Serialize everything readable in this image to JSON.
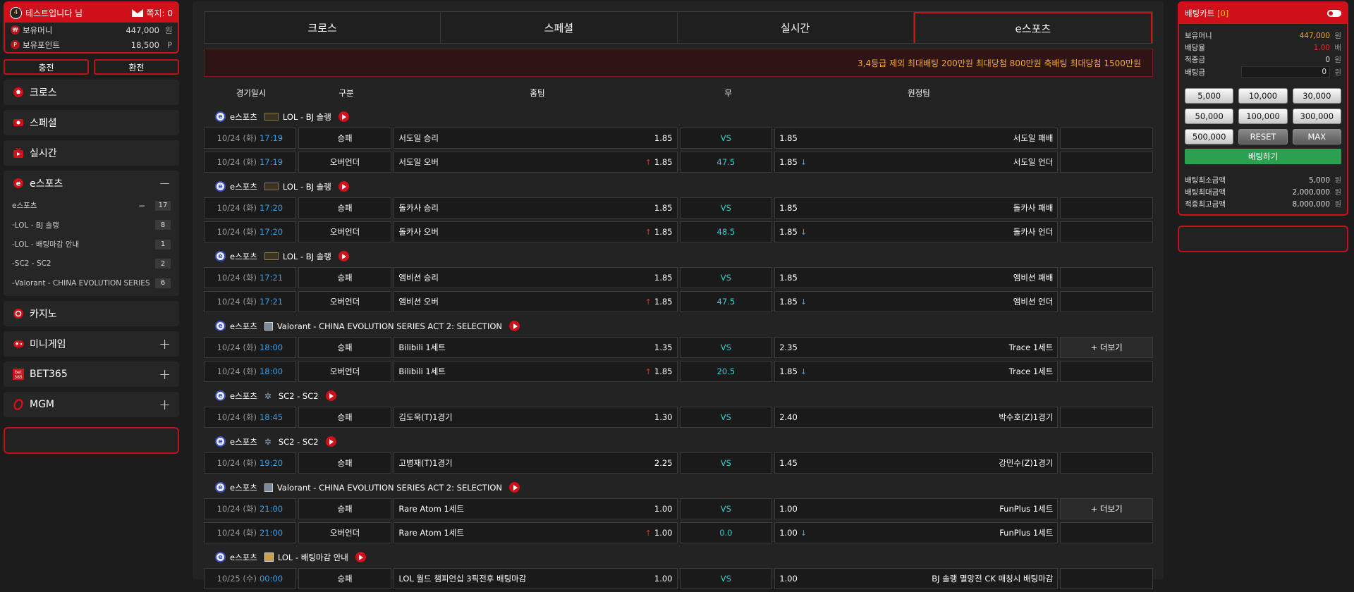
{
  "user": {
    "level": "4",
    "name": "테스트입니다 님",
    "mail_label": "쪽지: 0",
    "money_label": "보유머니",
    "money_value": "447,000",
    "money_unit": "원",
    "point_label": "보유포인트",
    "point_value": "18,500",
    "point_unit": "P"
  },
  "cash": {
    "charge": "충전",
    "exchange": "환전"
  },
  "menu": {
    "cross": "크로스",
    "special": "스페셜",
    "live": "실시간",
    "esports": "e스포츠",
    "esports_sub": [
      {
        "label": "e스포츠",
        "count": "17",
        "top": true
      },
      {
        "label": "LOL - BJ 솔랭",
        "count": "8"
      },
      {
        "label": "LOL - 배팅마감 안내",
        "count": "1"
      },
      {
        "label": "SC2 - SC2",
        "count": "2"
      },
      {
        "label": "Valorant - CHINA EVOLUTION SERIES ACT 2: SELECTION",
        "count": "6"
      }
    ],
    "casino": "카지노",
    "minigame": "미니게임",
    "bet365": "BET365",
    "mgm": "MGM"
  },
  "tabs": [
    "크로스",
    "스페셜",
    "실시간",
    "e스포츠"
  ],
  "notice": "3,4등급 제외 최대배팅 200만원 최대당첨 800만원 축배팅 최대당첨 1500만원",
  "headers": {
    "time": "경기일시",
    "type": "구분",
    "home": "홈팀",
    "draw": "무",
    "away": "원정팀"
  },
  "groups": [
    {
      "sport": "e스포츠",
      "league": "LOL - BJ 솔랭",
      "icon": "lol-bj-icon",
      "rows": [
        {
          "date": "10/24 (화)",
          "time": "17:19",
          "type": "승패",
          "home": "서도일 승리",
          "home_odds": "1.85",
          "draw": "VS",
          "away_odds": "1.85",
          "away": "서도일 패배",
          "more": ""
        },
        {
          "date": "10/24 (화)",
          "time": "17:19",
          "type": "오버언더",
          "home": "서도일 오버",
          "home_odds": "1.85",
          "draw": "47.5",
          "away_odds": "1.85",
          "away": "서도일 언더",
          "more": "",
          "ou": true
        }
      ]
    },
    {
      "sport": "e스포츠",
      "league": "LOL - BJ 솔랭",
      "icon": "lol-bj-icon",
      "rows": [
        {
          "date": "10/24 (화)",
          "time": "17:20",
          "type": "승패",
          "home": "돌카사 승리",
          "home_odds": "1.85",
          "draw": "VS",
          "away_odds": "1.85",
          "away": "돌카사 패배",
          "more": ""
        },
        {
          "date": "10/24 (화)",
          "time": "17:20",
          "type": "오버언더",
          "home": "돌카사 오버",
          "home_odds": "1.85",
          "draw": "48.5",
          "away_odds": "1.85",
          "away": "돌카사 언더",
          "more": "",
          "ou": true
        }
      ]
    },
    {
      "sport": "e스포츠",
      "league": "LOL - BJ 솔랭",
      "icon": "lol-bj-icon",
      "rows": [
        {
          "date": "10/24 (화)",
          "time": "17:21",
          "type": "승패",
          "home": "앰비션 승리",
          "home_odds": "1.85",
          "draw": "VS",
          "away_odds": "1.85",
          "away": "앰비션 패배",
          "more": ""
        },
        {
          "date": "10/24 (화)",
          "time": "17:21",
          "type": "오버언더",
          "home": "앰비션 오버",
          "home_odds": "1.85",
          "draw": "47.5",
          "away_odds": "1.85",
          "away": "앰비션 언더",
          "more": "",
          "ou": true
        }
      ]
    },
    {
      "sport": "e스포츠",
      "league": "Valorant - CHINA EVOLUTION SERIES ACT 2: SELECTION",
      "icon": "valorant-icon",
      "rows": [
        {
          "date": "10/24 (화)",
          "time": "18:00",
          "type": "승패",
          "home": "Bilibili 1세트",
          "home_odds": "1.35",
          "draw": "VS",
          "away_odds": "2.35",
          "away": "Trace 1세트",
          "more": "+ 더보기"
        },
        {
          "date": "10/24 (화)",
          "time": "18:00",
          "type": "오버언더",
          "home": "Bilibili 1세트",
          "home_odds": "1.85",
          "draw": "20.5",
          "away_odds": "1.85",
          "away": "Trace 1세트",
          "more": "",
          "ou": true
        }
      ]
    },
    {
      "sport": "e스포츠",
      "league": "SC2 - SC2",
      "icon": "sc2-icon",
      "rows": [
        {
          "date": "10/24 (화)",
          "time": "18:45",
          "type": "승패",
          "home": "김도욱(T)1경기",
          "home_odds": "1.30",
          "draw": "VS",
          "away_odds": "2.40",
          "away": "박수호(Z)1경기",
          "more": ""
        }
      ]
    },
    {
      "sport": "e스포츠",
      "league": "SC2 - SC2",
      "icon": "sc2-icon",
      "rows": [
        {
          "date": "10/24 (화)",
          "time": "19:20",
          "type": "승패",
          "home": "고병재(T)1경기",
          "home_odds": "2.25",
          "draw": "VS",
          "away_odds": "1.45",
          "away": "강민수(Z)1경기",
          "more": ""
        }
      ]
    },
    {
      "sport": "e스포츠",
      "league": "Valorant - CHINA EVOLUTION SERIES ACT 2: SELECTION",
      "icon": "valorant-icon",
      "rows": [
        {
          "date": "10/24 (화)",
          "time": "21:00",
          "type": "승패",
          "home": "Rare Atom 1세트",
          "home_odds": "1.00",
          "draw": "VS",
          "away_odds": "1.00",
          "away": "FunPlus 1세트",
          "more": "+ 더보기"
        },
        {
          "date": "10/24 (화)",
          "time": "21:00",
          "type": "오버언더",
          "home": "Rare Atom 1세트",
          "home_odds": "1.00",
          "draw": "0.0",
          "away_odds": "1.00",
          "away": "FunPlus 1세트",
          "more": "",
          "ou": true
        }
      ]
    },
    {
      "sport": "e스포츠",
      "league": "LOL - 배팅마감 안내",
      "icon": "lol-icon",
      "rows": [
        {
          "date": "10/25 (수)",
          "time": "00:00",
          "type": "승패",
          "home": "LOL 월드 챔피언십 3픽전후 배팅마감",
          "home_odds": "1.00",
          "draw": "VS",
          "away_odds": "1.00",
          "away": "BJ 솔랭 멸망전 CK 매칭시 배팅마감",
          "more": ""
        }
      ]
    }
  ],
  "cart": {
    "title": "배팅카트",
    "count": "[0]",
    "money_label": "보유머니",
    "money_value": "447,000",
    "money_unit": "원",
    "rate_label": "배당율",
    "rate_value": "1.00",
    "rate_unit": "배",
    "win_label": "적중금",
    "win_value": "0",
    "win_unit": "원",
    "bet_label": "배팅금",
    "bet_value": "0",
    "bet_unit": "원",
    "amounts": [
      "5,000",
      "10,000",
      "30,000",
      "50,000",
      "100,000",
      "300,000",
      "500,000"
    ],
    "reset": "RESET",
    "max": "MAX",
    "bet_button": "배팅하기",
    "min_label": "배팅최소금액",
    "min_value": "5,000",
    "min_unit": "원",
    "max_label": "배팅최대금액",
    "max_value": "2,000,000",
    "max_unit": "원",
    "maxwin_label": "적중최고금액",
    "maxwin_value": "8,000,000",
    "maxwin_unit": "원"
  },
  "colors": {
    "accent": "#d0101a",
    "odds_draw": "#35d0d0",
    "time": "#3aa0e8",
    "notice": "#f0a830",
    "bet": "#2aa050"
  }
}
